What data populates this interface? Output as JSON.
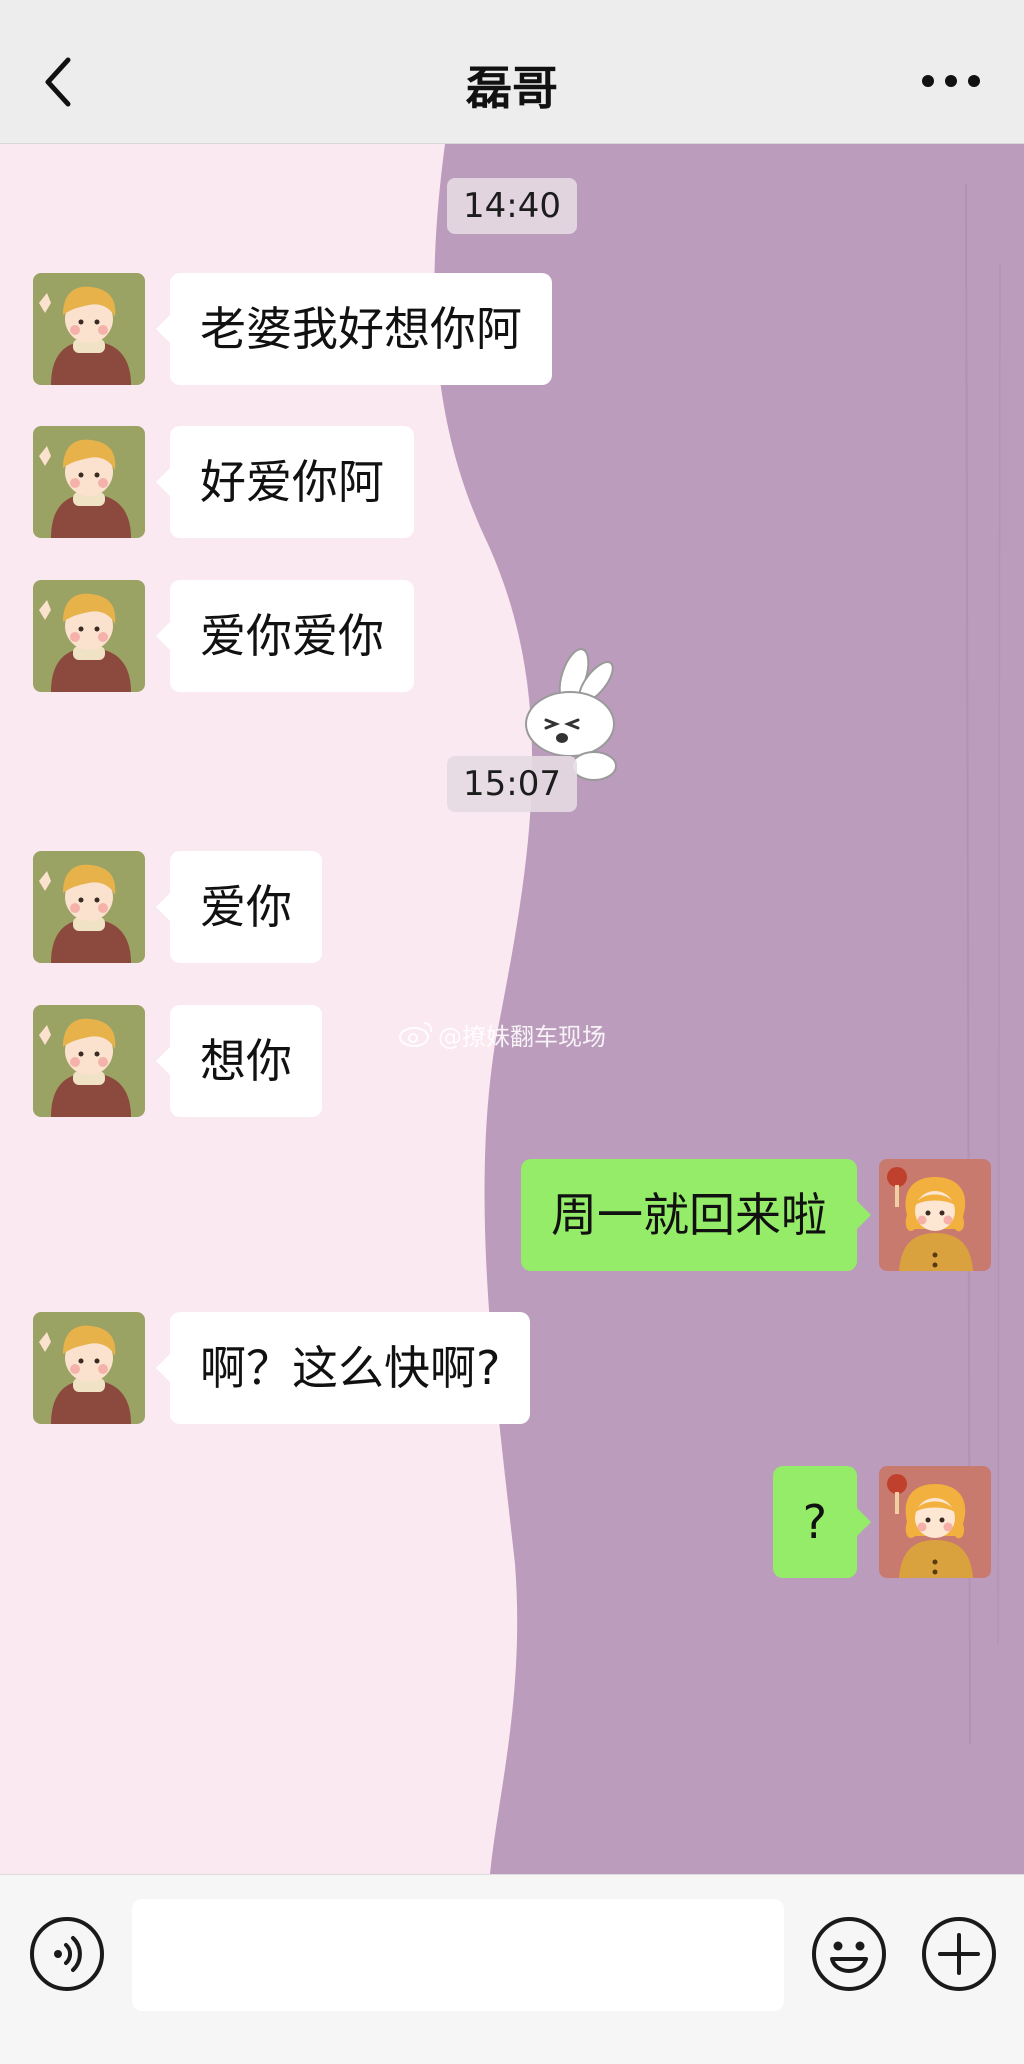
{
  "header": {
    "title": "磊哥",
    "back_icon": "chevron-left-icon",
    "more_icon": "more-dots-icon"
  },
  "messages": {
    "ts1": "14:40",
    "m1": "老婆我好想你阿",
    "m2": "好爱你阿",
    "m3": "爱你爱你",
    "ts2": "15:07",
    "m4": "爱你",
    "m5": "想你",
    "m6": "周一就回来啦",
    "m7": "啊？这么快啊?",
    "m8": "?"
  },
  "watermark": {
    "text": "@撩妹翻车现场"
  },
  "input_bar": {
    "voice_icon": "voice-icon",
    "emoji_icon": "emoji-icon",
    "plus_icon": "plus-icon"
  },
  "colors": {
    "incoming_bubble": "#ffffff",
    "outgoing_bubble": "#95ec69",
    "background_pink": "#fbe9f1",
    "background_purple": "#bb9cbc"
  }
}
